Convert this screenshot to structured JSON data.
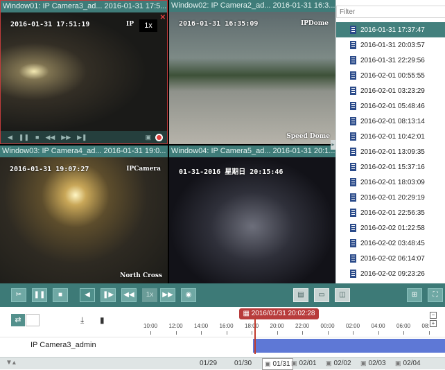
{
  "windows": [
    {
      "title": "Window01: IP Camera3_ad...  2016-01-31 17:5...",
      "osd_time": "2016-01-31 17:51:19",
      "osd_cam": "IP",
      "speed": "1x"
    },
    {
      "title": "Window02: IP Camera2_ad...  2016-01-31 16:3...",
      "osd_time": "2016-01-31 16:35:09",
      "osd_cam": "IPDome",
      "osd_bottom": "Speed Dome"
    },
    {
      "title": "Window03: IP Camera4_ad...  2016-01-31 19:0...",
      "osd_time": "2016-01-31 19:07:27",
      "osd_cam": "IPCamera",
      "osd_bottom": "North Cross"
    },
    {
      "title": "Window04: IP Camera5_ad...  2016-01-31 20:1...",
      "osd_time": "01-31-2016 星期日 20:15:46"
    }
  ],
  "filter": {
    "placeholder": "Filter"
  },
  "files": [
    "2016-01-31 17:37:47",
    "2016-01-31 20:03:57",
    "2016-01-31 22:29:56",
    "2016-02-01 00:55:55",
    "2016-02-01 03:23:29",
    "2016-02-01 05:48:46",
    "2016-02-01 08:13:14",
    "2016-02-01 10:42:01",
    "2016-02-01 13:09:35",
    "2016-02-01 15:37:16",
    "2016-02-01 18:03:09",
    "2016-02-01 20:29:19",
    "2016-02-01 22:56:35",
    "2016-02-02 01:22:58",
    "2016-02-02 03:48:45",
    "2016-02-02 06:14:07",
    "2016-02-02 09:23:26"
  ],
  "selected_file_index": 0,
  "toolbar": {
    "speed": "1x"
  },
  "timeline": {
    "current_datetime": "2016/01/31 20:02:28",
    "ticks": [
      "10:00",
      "12:00",
      "14:00",
      "16:00",
      "18:00",
      "20:00",
      "22:00",
      "00:00",
      "02:00",
      "04:00",
      "06:00",
      "08:"
    ],
    "track_label": "IP Camera3_admin"
  },
  "dates": [
    "01/29",
    "01/30",
    "01/31",
    "02/01",
    "02/02",
    "02/03",
    "02/04"
  ],
  "active_date": "01/31",
  "colors": {
    "accent": "#3d7a77",
    "selected": "#43807d",
    "record_bar": "#5e78d6",
    "cursor": "#c0392b"
  }
}
